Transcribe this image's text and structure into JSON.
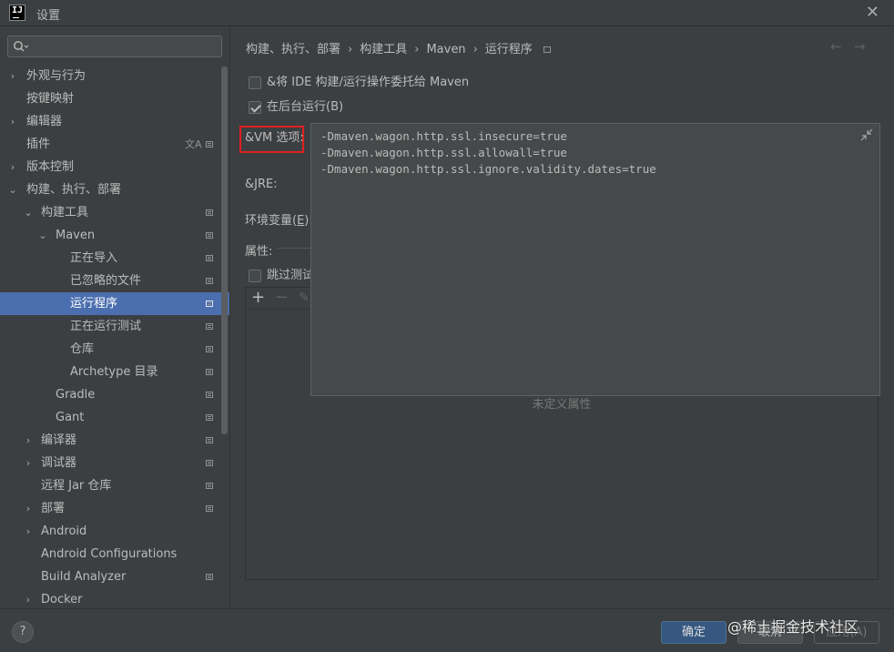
{
  "window": {
    "title": "设置",
    "app_icon_text": "IJ"
  },
  "search": {
    "placeholder": ""
  },
  "sidebar": {
    "items": [
      {
        "label": "外观与行为",
        "arrow": "›",
        "level": 0
      },
      {
        "label": "按键映射",
        "arrow": "",
        "level": 0
      },
      {
        "label": "编辑器",
        "arrow": "›",
        "level": 0
      },
      {
        "label": "插件",
        "arrow": "",
        "level": 0
      },
      {
        "label": "版本控制",
        "arrow": "›",
        "level": 0
      },
      {
        "label": "构建、执行、部署",
        "arrow": "⌄",
        "level": 0
      },
      {
        "label": "构建工具",
        "arrow": "⌄",
        "level": 1
      },
      {
        "label": "Maven",
        "arrow": "⌄",
        "level": 2
      },
      {
        "label": "正在导入",
        "arrow": "",
        "level": 3
      },
      {
        "label": "已忽略的文件",
        "arrow": "",
        "level": 3
      },
      {
        "label": "运行程序",
        "arrow": "",
        "level": 3,
        "selected": true
      },
      {
        "label": "正在运行测试",
        "arrow": "",
        "level": 3
      },
      {
        "label": "仓库",
        "arrow": "",
        "level": 3
      },
      {
        "label": "Archetype 目录",
        "arrow": "",
        "level": 3
      },
      {
        "label": "Gradle",
        "arrow": "",
        "level": 2
      },
      {
        "label": "Gant",
        "arrow": "",
        "level": 2
      },
      {
        "label": "编译器",
        "arrow": "›",
        "level": 1
      },
      {
        "label": "调试器",
        "arrow": "›",
        "level": 1
      },
      {
        "label": "远程 Jar 仓库",
        "arrow": "",
        "level": 1
      },
      {
        "label": "部署",
        "arrow": "›",
        "level": 1
      },
      {
        "label": "Android",
        "arrow": "›",
        "level": 1
      },
      {
        "label": "Android Configurations",
        "arrow": "",
        "level": 1
      },
      {
        "label": "Build Analyzer",
        "arrow": "",
        "level": 1
      },
      {
        "label": "Docker",
        "arrow": "›",
        "level": 1
      }
    ]
  },
  "breadcrumb": {
    "items": [
      "构建、执行、部署",
      "构建工具",
      "Maven",
      "运行程序"
    ],
    "separator": "›"
  },
  "nav": {
    "back": "←",
    "forward": "→"
  },
  "runner": {
    "delegate_label": "&将 IDE 构建/运行操作委托给 Maven",
    "delegate_checked": false,
    "background_label": "在后台运行(B)",
    "background_checked": true,
    "vm_label": "&VM 选项:",
    "jre_label": "&JRE:",
    "env_label_prefix": "环境变量(",
    "env_label_mnemonic": "E",
    "env_label_suffix": "):",
    "props_label": "属性:",
    "skip_tests_label": "跳过测试",
    "skip_tests_checked": false,
    "props_empty_text": "未定义属性",
    "vm_options": "-Dmaven.wagon.http.ssl.insecure=true\n-Dmaven.wagon.http.ssl.allowall=true\n-Dmaven.wagon.http.ssl.ignore.validity.dates=true"
  },
  "toolbar": {
    "add": "+",
    "remove": "−",
    "edit": "✎"
  },
  "buttons": {
    "ok": "确定",
    "cancel": "取消",
    "apply": "应用(A)",
    "help": "?"
  },
  "watermark": "@稀土掘金技术社区",
  "colors": {
    "selection": "#4b6eaf",
    "highlight_box": "#e0201e",
    "primary_button": "#365880"
  }
}
